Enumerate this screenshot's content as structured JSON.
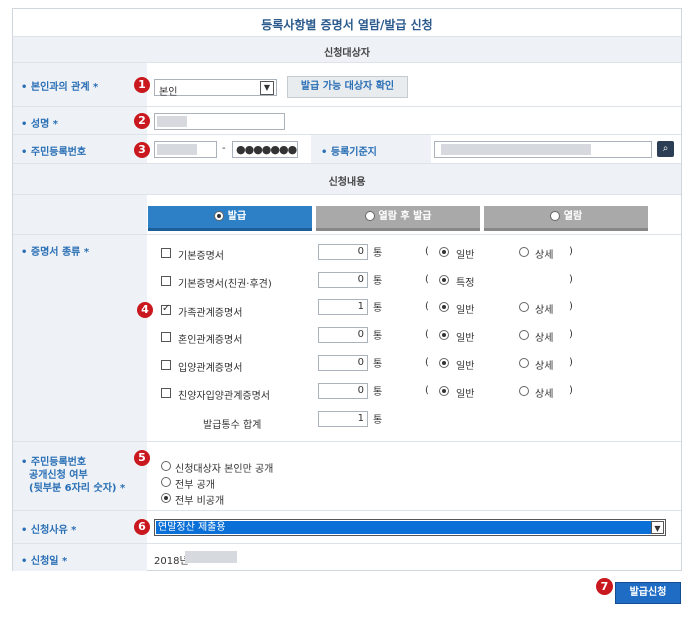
{
  "title": "등록사항별 증명서 열람/발급 신청",
  "applicant_section": "신청대상자",
  "relation": {
    "label": "• 본인과의 관계 *",
    "value": "본인",
    "check_button": "발급 가능 대상자 확인"
  },
  "name": {
    "label": "• 성명 *"
  },
  "resident": {
    "label": "• 주민등록번호",
    "dash": "-",
    "masked": "●●●●●●●",
    "base_label": "• 등록기준지"
  },
  "content_section": "신청내용",
  "tabs": [
    "발급",
    "열람 후 발급",
    "열람"
  ],
  "cert": {
    "label": "• 증명서 종류 *",
    "unit": "통",
    "open": "(",
    "close": ")",
    "items": [
      {
        "name": "기본증명서",
        "qty": "0",
        "checked": false,
        "opt1": "일반",
        "opt2": "상세"
      },
      {
        "name": "기본증명서(친권·후견)",
        "qty": "0",
        "checked": false,
        "opt1": "특정",
        "opt2": ""
      },
      {
        "name": "가족관계증명서",
        "qty": "1",
        "checked": true,
        "opt1": "일반",
        "opt2": "상세"
      },
      {
        "name": "혼인관계증명서",
        "qty": "0",
        "checked": false,
        "opt1": "일반",
        "opt2": "상세"
      },
      {
        "name": "입양관계증명서",
        "qty": "0",
        "checked": false,
        "opt1": "일반",
        "opt2": "상세"
      },
      {
        "name": "친양자입양관계증명서",
        "qty": "0",
        "checked": false,
        "opt1": "일반",
        "opt2": "상세"
      }
    ],
    "total_label": "발급통수 합계",
    "total_qty": "1"
  },
  "disclosure": {
    "label_lines": [
      "• 주민등록번호",
      "공개신청 여부",
      "(뒷부분 6자리 숫자) *"
    ],
    "options": [
      "신청대상자 본인만 공개",
      "전부 공개",
      "전부 비공개"
    ]
  },
  "reason": {
    "label": "• 신청사유 *",
    "value": "연말정산 제출용"
  },
  "date": {
    "label": "• 신청일 *",
    "value": "2018년"
  },
  "markers": [
    "1",
    "2",
    "3",
    "4",
    "5",
    "6",
    "7"
  ],
  "submit": "발급신청",
  "colors": {
    "accent": "#2a6fb5",
    "marker": "#c9191f",
    "tab_active": "#2d7fc6",
    "tab_inactive": "#a9a9a9",
    "select_highlight": "#0a6fd6"
  }
}
